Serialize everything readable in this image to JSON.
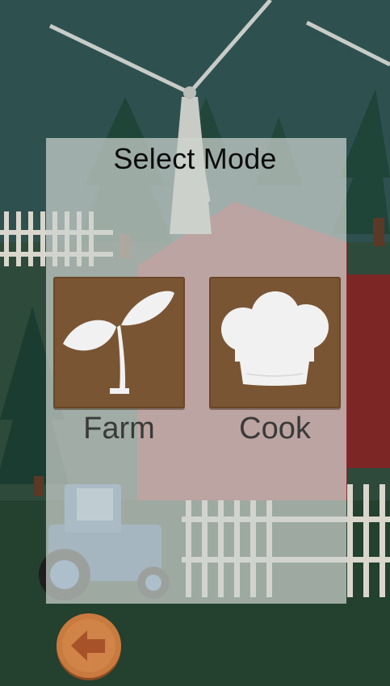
{
  "screen": {
    "title": "Select Mode"
  },
  "modes": [
    {
      "label": "Farm",
      "icon": "sprout-icon"
    },
    {
      "label": "Cook",
      "icon": "chef-hat-icon"
    }
  ],
  "back_button": {
    "icon": "back-arrow-icon"
  },
  "colors": {
    "panel_overlay": "#cdd2ce",
    "button_wood": "#7a5533",
    "back_button_wood": "#c97a3e",
    "label_text": "#3a3a3a",
    "title_text": "#0c0c0c"
  }
}
